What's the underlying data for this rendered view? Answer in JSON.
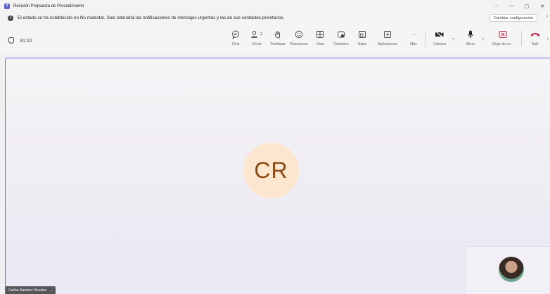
{
  "window": {
    "title": "Revisión Propuesta de Procedimiento",
    "controls": [
      "···",
      "—",
      "▢",
      "✕"
    ]
  },
  "notification": {
    "message": "El estado se ha establecido en No molestar. Solo obtendrá las notificaciones de mensajes urgentes y las de sus contactos prioritarios.",
    "button": "Cambiar configuración",
    "more": "›"
  },
  "toolbar": {
    "timer": "31:22",
    "items": [
      {
        "label": "Chat",
        "icon": "chat-icon",
        "glyph": "💬"
      },
      {
        "label": "Gente",
        "icon": "people-icon",
        "glyph": "👥",
        "count": "2"
      },
      {
        "label": "Participar",
        "icon": "raise-hand-icon",
        "glyph": "✋"
      },
      {
        "label": "Reaccionar",
        "icon": "smiley-icon",
        "glyph": "☺"
      },
      {
        "label": "Vista",
        "icon": "view-grid-icon",
        "glyph": "⊞"
      },
      {
        "label": "Controles",
        "icon": "controls-icon",
        "glyph": "⚙"
      },
      {
        "label": "Salas",
        "icon": "rooms-icon",
        "glyph": "⧉"
      },
      {
        "label": "Aplicaciones",
        "icon": "apps-icon",
        "glyph": "⊕"
      },
      {
        "label": "Más",
        "icon": "more-icon",
        "glyph": "···"
      }
    ],
    "camera": {
      "label": "Cámara",
      "glyph": "📹"
    },
    "mic": {
      "label": "Micro",
      "glyph": "🎙"
    },
    "share": {
      "label": "Dejar de co...",
      "glyph": "⊠"
    },
    "leave": {
      "label": "Salir",
      "glyph": "☎"
    }
  },
  "stage": {
    "avatar_initials": "CR",
    "participant_name": "Carlos Ramírez Rosales",
    "participant_more": "···"
  },
  "colors": {
    "accent": "#6b6cf0",
    "avatar_bg": "#fde6cf",
    "avatar_text": "#8a4a16",
    "leave": "#c4314b"
  }
}
